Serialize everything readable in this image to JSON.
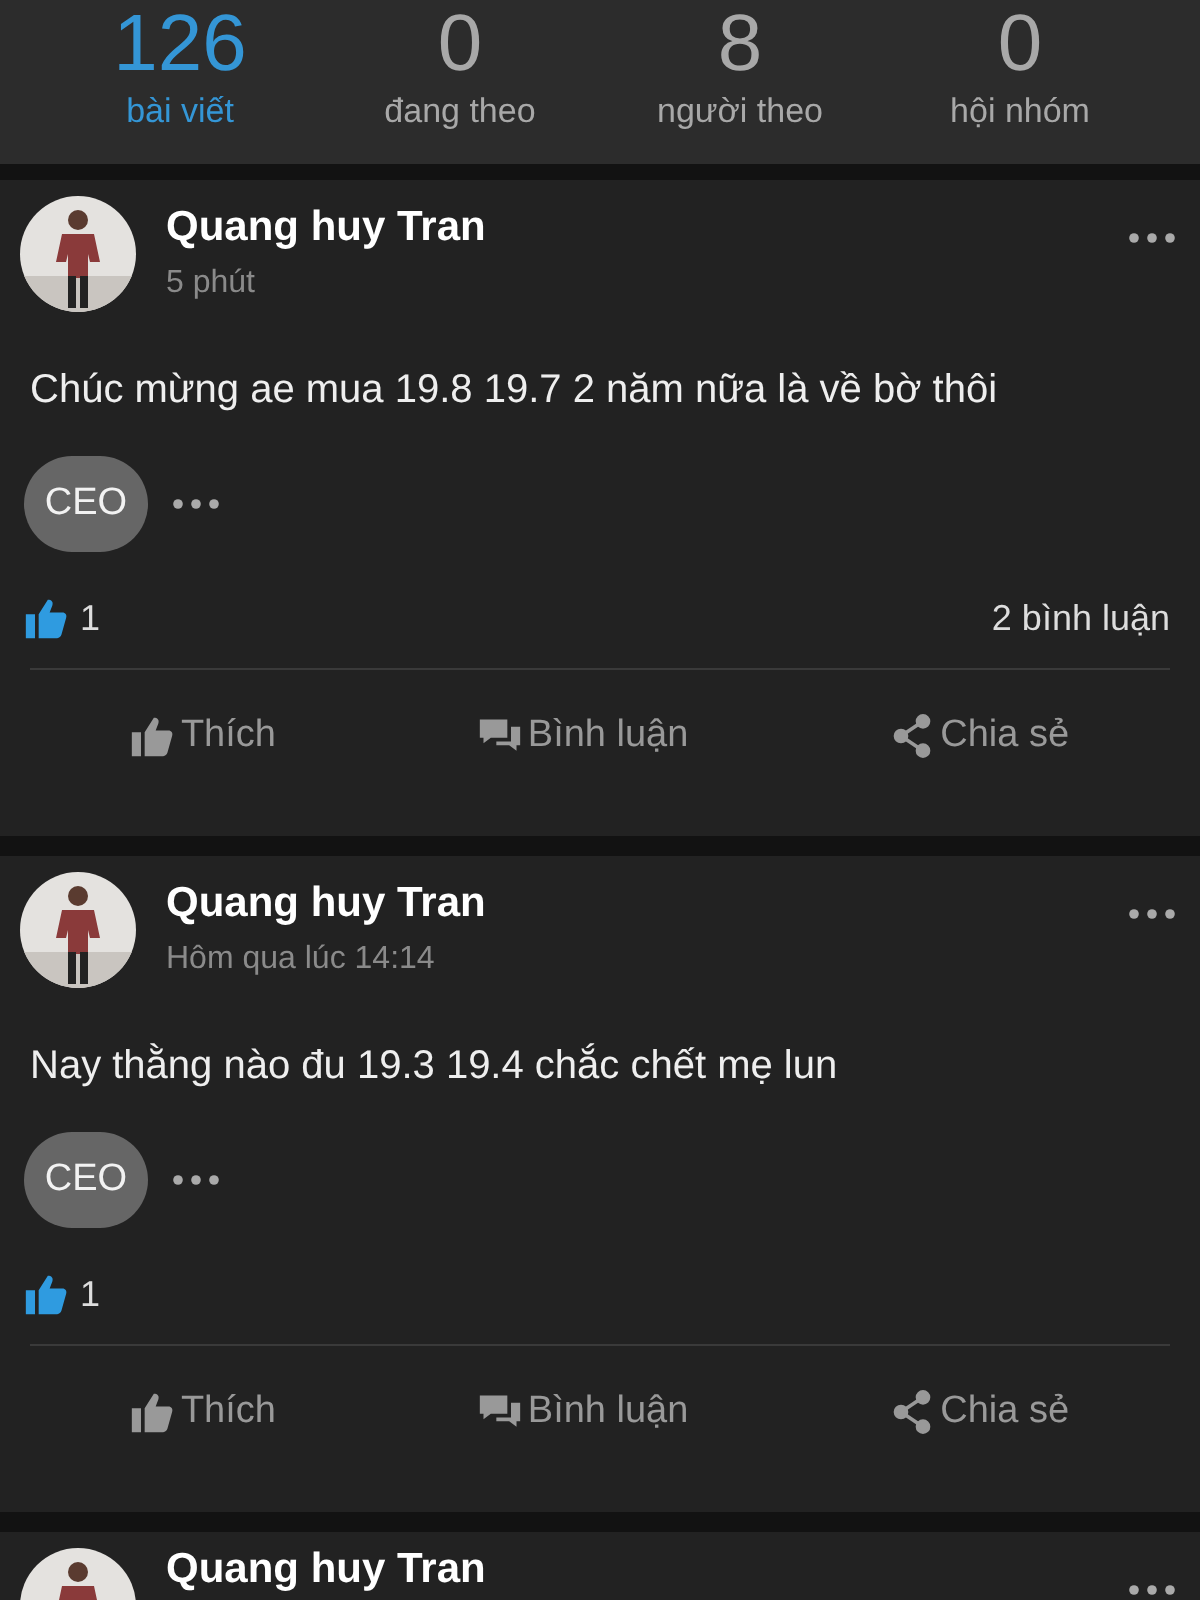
{
  "stats": [
    {
      "count": "126",
      "label": "bài viết",
      "selected": true
    },
    {
      "count": "0",
      "label": "đang theo",
      "selected": false
    },
    {
      "count": "8",
      "label": "người theo",
      "selected": false
    },
    {
      "count": "0",
      "label": "hội nhóm",
      "selected": false
    }
  ],
  "posts": [
    {
      "author": "Quang huy Tran",
      "time": "5 phút",
      "text": "Chúc mừng ae mua 19.8 19.7 2 năm nữa là về bờ thôi",
      "badge": "CEO",
      "likes": "1",
      "comments": "2 bình luận",
      "actions": [
        "Thích",
        "Bình luận",
        "Chia sẻ"
      ]
    },
    {
      "author": "Quang huy Tran",
      "time": "Hôm qua lúc 14:14",
      "text": "Nay thằng nào đu 19.3 19.4 chắc chết mẹ lun",
      "badge": "CEO",
      "likes": "1",
      "actions": [
        "Thích",
        "Bình luận",
        "Chia sẻ"
      ]
    },
    {
      "author": "Quang huy Tran"
    }
  ]
}
